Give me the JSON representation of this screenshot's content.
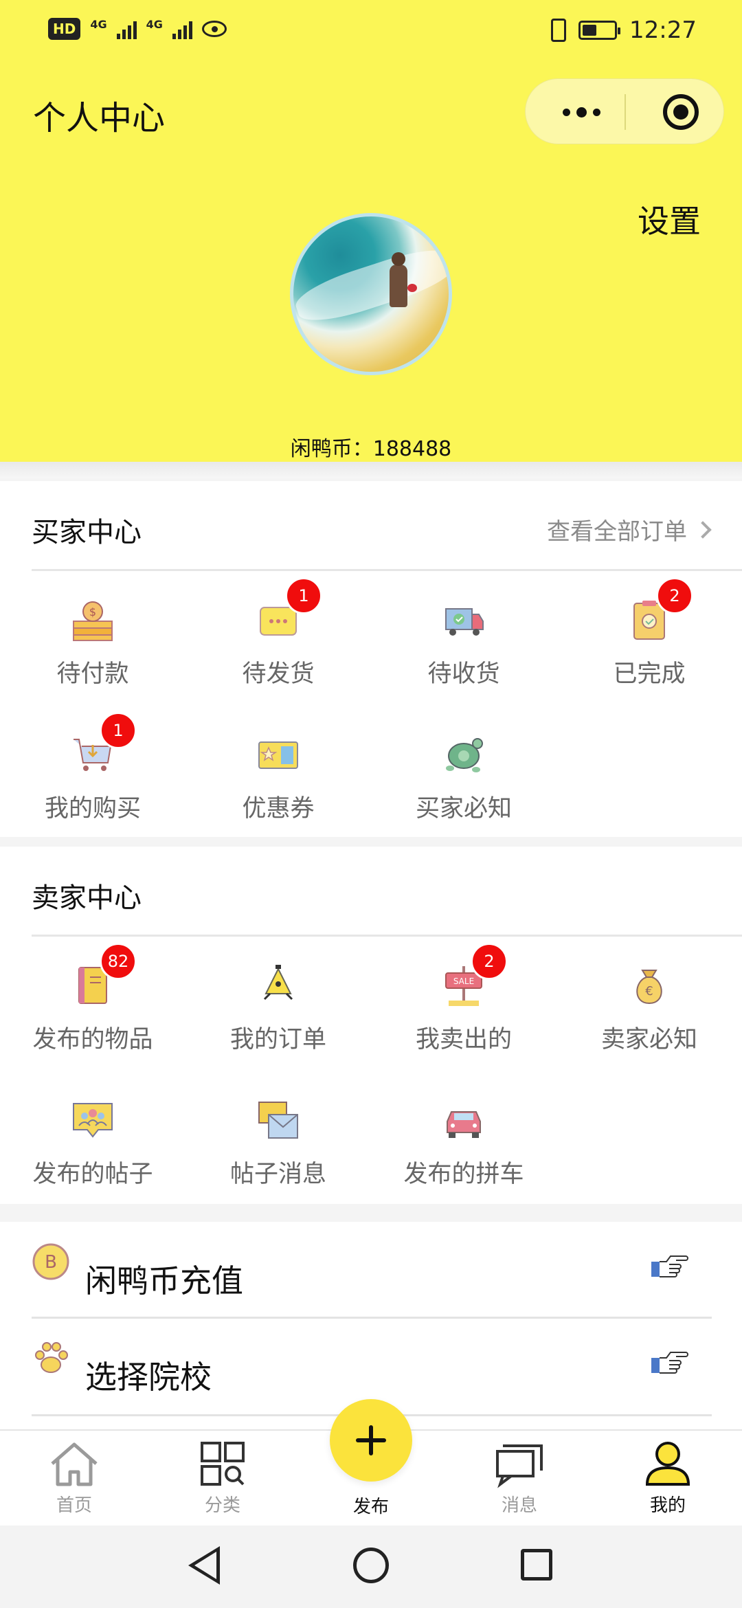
{
  "status_bar": {
    "left": "HD",
    "network_1": "4G",
    "network_2": "4G",
    "time": "12:27"
  },
  "header": {
    "title": "个人中心",
    "settings_label": "设置",
    "coins_text": "闲鸭币：188488",
    "background_color": "#fbf656"
  },
  "buyer_center": {
    "title": "买家中心",
    "all_orders_label": "查看全部订单",
    "items": [
      {
        "label": "待付款",
        "badge": null,
        "icon": "payment-pending-icon"
      },
      {
        "label": "待发货",
        "badge": "1",
        "icon": "awaiting-shipment-icon"
      },
      {
        "label": "待收货",
        "badge": null,
        "icon": "delivery-truck-icon"
      },
      {
        "label": "已完成",
        "badge": "2",
        "icon": "completed-clipboard-icon"
      },
      {
        "label": "我的购买",
        "badge": "1",
        "icon": "shopping-cart-icon"
      },
      {
        "label": "优惠券",
        "badge": null,
        "icon": "coupon-icon"
      },
      {
        "label": "买家必知",
        "badge": null,
        "icon": "turtle-icon"
      }
    ]
  },
  "seller_center": {
    "title": "卖家中心",
    "items": [
      {
        "label": "发布的物品",
        "badge": "82",
        "icon": "notebook-icon"
      },
      {
        "label": "我的订单",
        "badge": null,
        "icon": "lamp-icon"
      },
      {
        "label": "我卖出的",
        "badge": "2",
        "icon": "sale-sign-icon"
      },
      {
        "label": "卖家必知",
        "badge": null,
        "icon": "money-bag-icon"
      },
      {
        "label": "发布的帖子",
        "badge": null,
        "icon": "group-chat-icon"
      },
      {
        "label": "帖子消息",
        "badge": null,
        "icon": "envelope-icon"
      },
      {
        "label": "发布的拼车",
        "badge": null,
        "icon": "car-icon"
      }
    ]
  },
  "misc": {
    "recharge_label": "闲鸭币充值",
    "select_school_label": "选择院校"
  },
  "tabbar": {
    "home": "首页",
    "category": "分类",
    "publish": "发布",
    "messages": "消息",
    "mine": "我的"
  },
  "colors": {
    "accent_yellow": "#fbf656",
    "publish_button": "#fbe33c",
    "badge_red": "#f00d0d"
  }
}
